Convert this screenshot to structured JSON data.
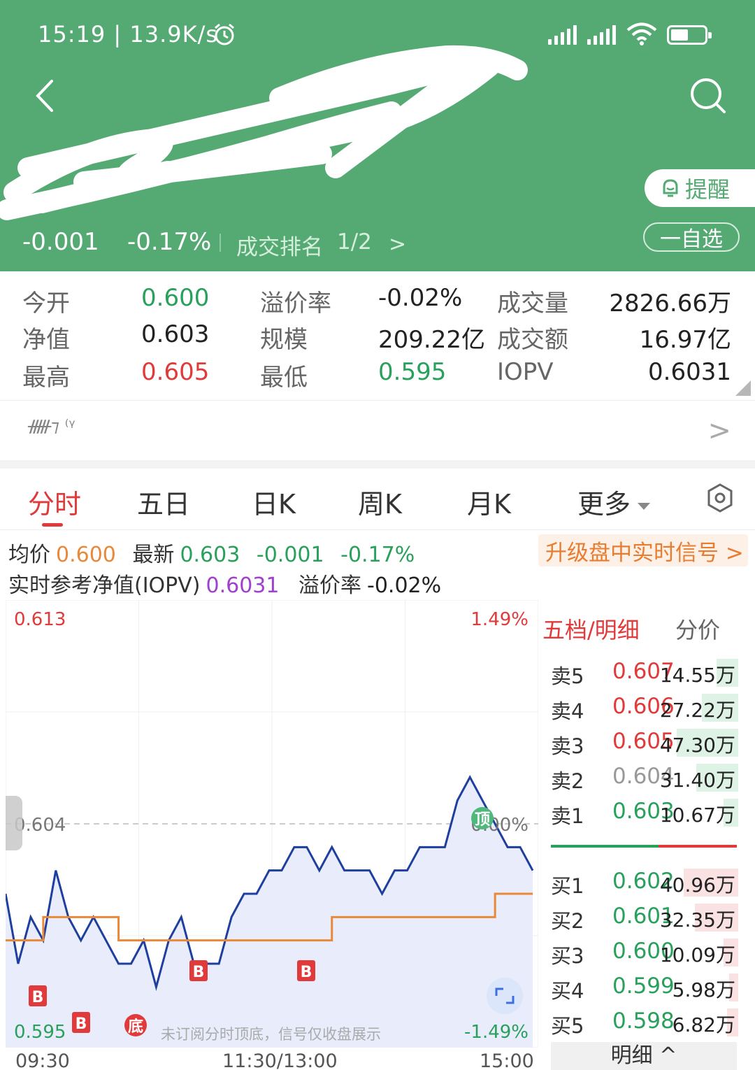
{
  "status_bar": {
    "time_speed": "15:19 | 13.9K/s"
  },
  "header": {
    "remind_label": "提醒",
    "watchlist_label": "一自选",
    "change_abs": "-0.001",
    "change_pct": "-0.17%",
    "rank_label": "成交排名",
    "rank_value": "1/2",
    "rank_chevron": ">"
  },
  "stats": {
    "open_label": "今开",
    "open_value": "0.600",
    "nav_label": "净值",
    "nav_value": "0.603",
    "high_label": "最高",
    "high_value": "0.605",
    "premium_label": "溢价率",
    "premium_value": "-0.02%",
    "scale_label": "规模",
    "scale_value": "209.22亿",
    "low_label": "最低",
    "low_value": "0.595",
    "volume_label": "成交量",
    "volume_value": "2826.66万",
    "amount_label": "成交额",
    "amount_value": "16.97亿",
    "iopv_label": "IOPV",
    "iopv_value": "0.6031"
  },
  "info_row": {
    "text": "ᚏ⁊ ⁽ᵞ",
    "chevron": ">"
  },
  "tabs": [
    {
      "label": "分时"
    },
    {
      "label": "五日"
    },
    {
      "label": "日K"
    },
    {
      "label": "周K"
    },
    {
      "label": "月K"
    },
    {
      "label": "更多"
    }
  ],
  "legend": {
    "avg_label": "均价",
    "avg_value": "0.600",
    "last_label": "最新",
    "last_value": "0.603",
    "last_chg": "-0.001",
    "last_pct": "-0.17%",
    "iopv_label": "实时参考净值(IOPV)",
    "iopv_value": "0.6031",
    "premium_label": "溢价率",
    "premium_value": "-0.02%",
    "upgrade_label": "升级盘中实时信号 >"
  },
  "chart_data": {
    "type": "line",
    "x_ticks": [
      "09:30",
      "11:30/13:00",
      "15:00"
    ],
    "y_left_ticks": [
      "0.613",
      "0.604",
      "0.595"
    ],
    "y_right_ticks": [
      "1.49%",
      "0.00%",
      "-1.49%"
    ],
    "ylim": [
      0.595,
      0.613
    ],
    "reference_price": 0.604,
    "notice": "未订阅分时顶底，信号仅收盘展示",
    "markers": [
      "B",
      "B",
      "底",
      "B",
      "B",
      "顶"
    ],
    "series": [
      {
        "name": "最新",
        "color": "#1e3f9e",
        "values": [
          0.601,
          0.598,
          0.6,
          0.599,
          0.602,
          0.6,
          0.599,
          0.6,
          0.599,
          0.598,
          0.598,
          0.599,
          0.597,
          0.599,
          0.6,
          0.598,
          0.598,
          0.598,
          0.6,
          0.601,
          0.601,
          0.602,
          0.602,
          0.603,
          0.603,
          0.602,
          0.603,
          0.602,
          0.602,
          0.602,
          0.601,
          0.602,
          0.602,
          0.603,
          0.603,
          0.603,
          0.605,
          0.606,
          0.605,
          0.604,
          0.603,
          0.603,
          0.602
        ]
      },
      {
        "name": "均价",
        "color": "#e8893a",
        "values": [
          0.599,
          0.599,
          0.599,
          0.6,
          0.6,
          0.6,
          0.6,
          0.6,
          0.6,
          0.599,
          0.599,
          0.599,
          0.599,
          0.599,
          0.599,
          0.599,
          0.599,
          0.599,
          0.599,
          0.599,
          0.599,
          0.599,
          0.599,
          0.599,
          0.599,
          0.599,
          0.6,
          0.6,
          0.6,
          0.6,
          0.6,
          0.6,
          0.6,
          0.6,
          0.6,
          0.6,
          0.6,
          0.6,
          0.6,
          0.601,
          0.601,
          0.601,
          0.601
        ]
      }
    ]
  },
  "order_book": {
    "tab_active": "五档/明细",
    "tab_other": "分价",
    "asks": [
      {
        "label": "卖5",
        "price": "0.607",
        "volume": "14.55万",
        "fill": 0.12,
        "price_color": "#e03a3a"
      },
      {
        "label": "卖4",
        "price": "0.606",
        "volume": "27.22万",
        "fill": 0.2,
        "price_color": "#e03a3a"
      },
      {
        "label": "卖3",
        "price": "0.605",
        "volume": "47.30万",
        "fill": 0.34,
        "price_color": "#e03a3a"
      },
      {
        "label": "卖2",
        "price": "0.604",
        "volume": "31.40万",
        "fill": 0.23,
        "price_color": "#999999"
      },
      {
        "label": "卖1",
        "price": "0.603",
        "volume": "10.67万",
        "fill": 0.08,
        "price_color": "#29a05c"
      }
    ],
    "bids": [
      {
        "label": "买1",
        "price": "0.602",
        "volume": "40.96万",
        "fill": 0.3,
        "price_color": "#29a05c"
      },
      {
        "label": "买2",
        "price": "0.601",
        "volume": "32.35万",
        "fill": 0.24,
        "price_color": "#29a05c"
      },
      {
        "label": "买3",
        "price": "0.600",
        "volume": "10.09万",
        "fill": 0.08,
        "price_color": "#29a05c"
      },
      {
        "label": "买4",
        "price": "0.599",
        "volume": "5.98万",
        "fill": 0.05,
        "price_color": "#29a05c"
      },
      {
        "label": "买5",
        "price": "0.598",
        "volume": "6.82万",
        "fill": 0.06,
        "price_color": "#29a05c"
      }
    ],
    "detail_label": "明细 ^"
  }
}
